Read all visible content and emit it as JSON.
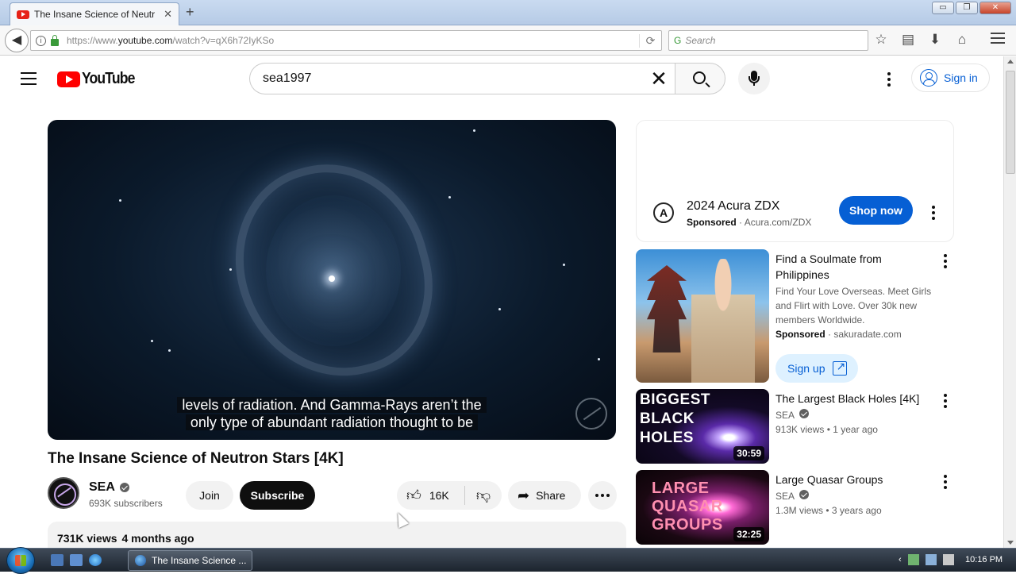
{
  "browser": {
    "tab_title": "The Insane Science of Neutr",
    "new_tab": "+",
    "url_prefix": "https://www.",
    "url_domain": "youtube.com",
    "url_path": "/watch?v=qX6h72IyKSo",
    "search_placeholder": "Search",
    "window_controls": [
      "▭",
      "❐",
      "✕"
    ]
  },
  "youtube": {
    "logo_text": "YouTube",
    "search_query": "sea1997",
    "sign_in": "Sign in"
  },
  "player": {
    "caption_line1": "levels of radiation. And Gamma-Rays aren’t the",
    "caption_line2": "only type of abundant radiation thought to be"
  },
  "video": {
    "title": "The Insane Science of Neutron Stars [4K]",
    "channel": "SEA",
    "subscribers": "693K subscribers",
    "join": "Join",
    "subscribe": "Subscribe",
    "likes": "16K",
    "share": "Share",
    "views": "731K views",
    "age": "4 months ago"
  },
  "sidebar": {
    "ad": {
      "title": "2024 Acura ZDX",
      "sponsored": "Sponsored",
      "domain": "Acura.com/ZDX",
      "cta": "Shop now"
    },
    "ad2": {
      "title": "Find a Soulmate from Philippines",
      "desc": "Find Your Love Overseas. Meet Girls and Flirt with Love. Over 30k new members Worldwide.",
      "sponsored": "Sponsored",
      "domain": "sakuradate.com",
      "cta": "Sign up"
    },
    "videos": [
      {
        "title": "The Largest Black Holes [4K]",
        "channel": "SEA",
        "views": "913K views",
        "age": "1 year ago",
        "duration": "30:59",
        "thumb_text": "BIGGEST BLACK HOLES"
      },
      {
        "title": "Large Quasar Groups",
        "channel": "SEA",
        "views": "1.3M views",
        "age": "3 years ago",
        "duration": "32:25",
        "thumb_text": "LARGE QUASAR GROUPS"
      }
    ]
  },
  "taskbar": {
    "task_title": "The Insane Science ...",
    "time": "10:16 PM"
  },
  "colors": {
    "youtube_red": "#ff0000",
    "link_blue": "#065fd4",
    "subscribe_bg": "#0f0f0f"
  }
}
